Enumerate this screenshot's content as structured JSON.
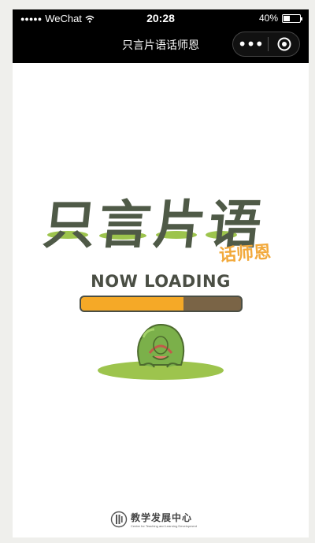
{
  "status_bar": {
    "carrier": "WeChat",
    "signal_dots": "●●●●●",
    "time": "20:28",
    "battery_percent": "40%",
    "battery_level": 0.4
  },
  "nav_bar": {
    "title": "只言片语话师恩",
    "more_label": "•••"
  },
  "logo": {
    "title": "只言片语",
    "subtitle": "话师恩"
  },
  "loading": {
    "text": "NOW LOADING",
    "progress": 0.64
  },
  "footer": {
    "org_name": "教学发展中心",
    "org_name_en": "Center for Teaching and Learning Development"
  },
  "colors": {
    "accent_orange": "#f5a927",
    "title_dark": "#4f5a47",
    "grass_green": "#9dc44d",
    "bar_brown": "#7a6446"
  }
}
